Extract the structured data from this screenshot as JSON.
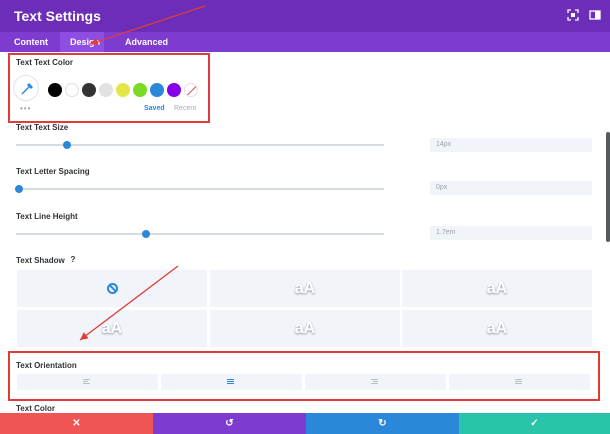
{
  "header": {
    "title": "Text Settings",
    "bg": "#6c2eb9",
    "icons": [
      "expand-icon",
      "sidebar-toggle-icon"
    ]
  },
  "tabs": [
    {
      "label": "Content",
      "active": false
    },
    {
      "label": "Design",
      "active": true
    },
    {
      "label": "Advanced",
      "active": false
    }
  ],
  "color_section": {
    "label": "Text Text Color",
    "swatches": [
      "#000000",
      "#ffffff",
      "#333333",
      "#e2e2e2",
      "#e5e54a",
      "#7cda24",
      "#2b87da",
      "#8300e9",
      "none"
    ],
    "saved_label": "Saved",
    "recent_label": "Recent"
  },
  "text_size": {
    "label": "Text Text Size",
    "value": "14px",
    "fraction": 0.17
  },
  "letter_spacing": {
    "label": "Text Letter Spacing",
    "value": "0px",
    "fraction": 0.0
  },
  "line_height": {
    "label": "Text Line Height",
    "value": "1.7em",
    "fraction": 0.35
  },
  "text_shadow": {
    "label": "Text Shadow",
    "help": "?",
    "preview_text": "aA"
  },
  "text_orientation": {
    "label": "Text Orientation",
    "options": [
      "left",
      "center",
      "right",
      "justify"
    ],
    "selected": "center"
  },
  "text_color_label": "Text Color",
  "footer": {
    "buttons": [
      {
        "name": "cancel",
        "icon": "✕",
        "color": "#ef5555"
      },
      {
        "name": "undo",
        "icon": "↺",
        "color": "#7e3bd0"
      },
      {
        "name": "redo",
        "icon": "↻",
        "color": "#2b87da"
      },
      {
        "name": "save",
        "icon": "✓",
        "color": "#29c4a9"
      }
    ]
  },
  "accent": "#2b87da",
  "annotation_color": "#e03a3a"
}
